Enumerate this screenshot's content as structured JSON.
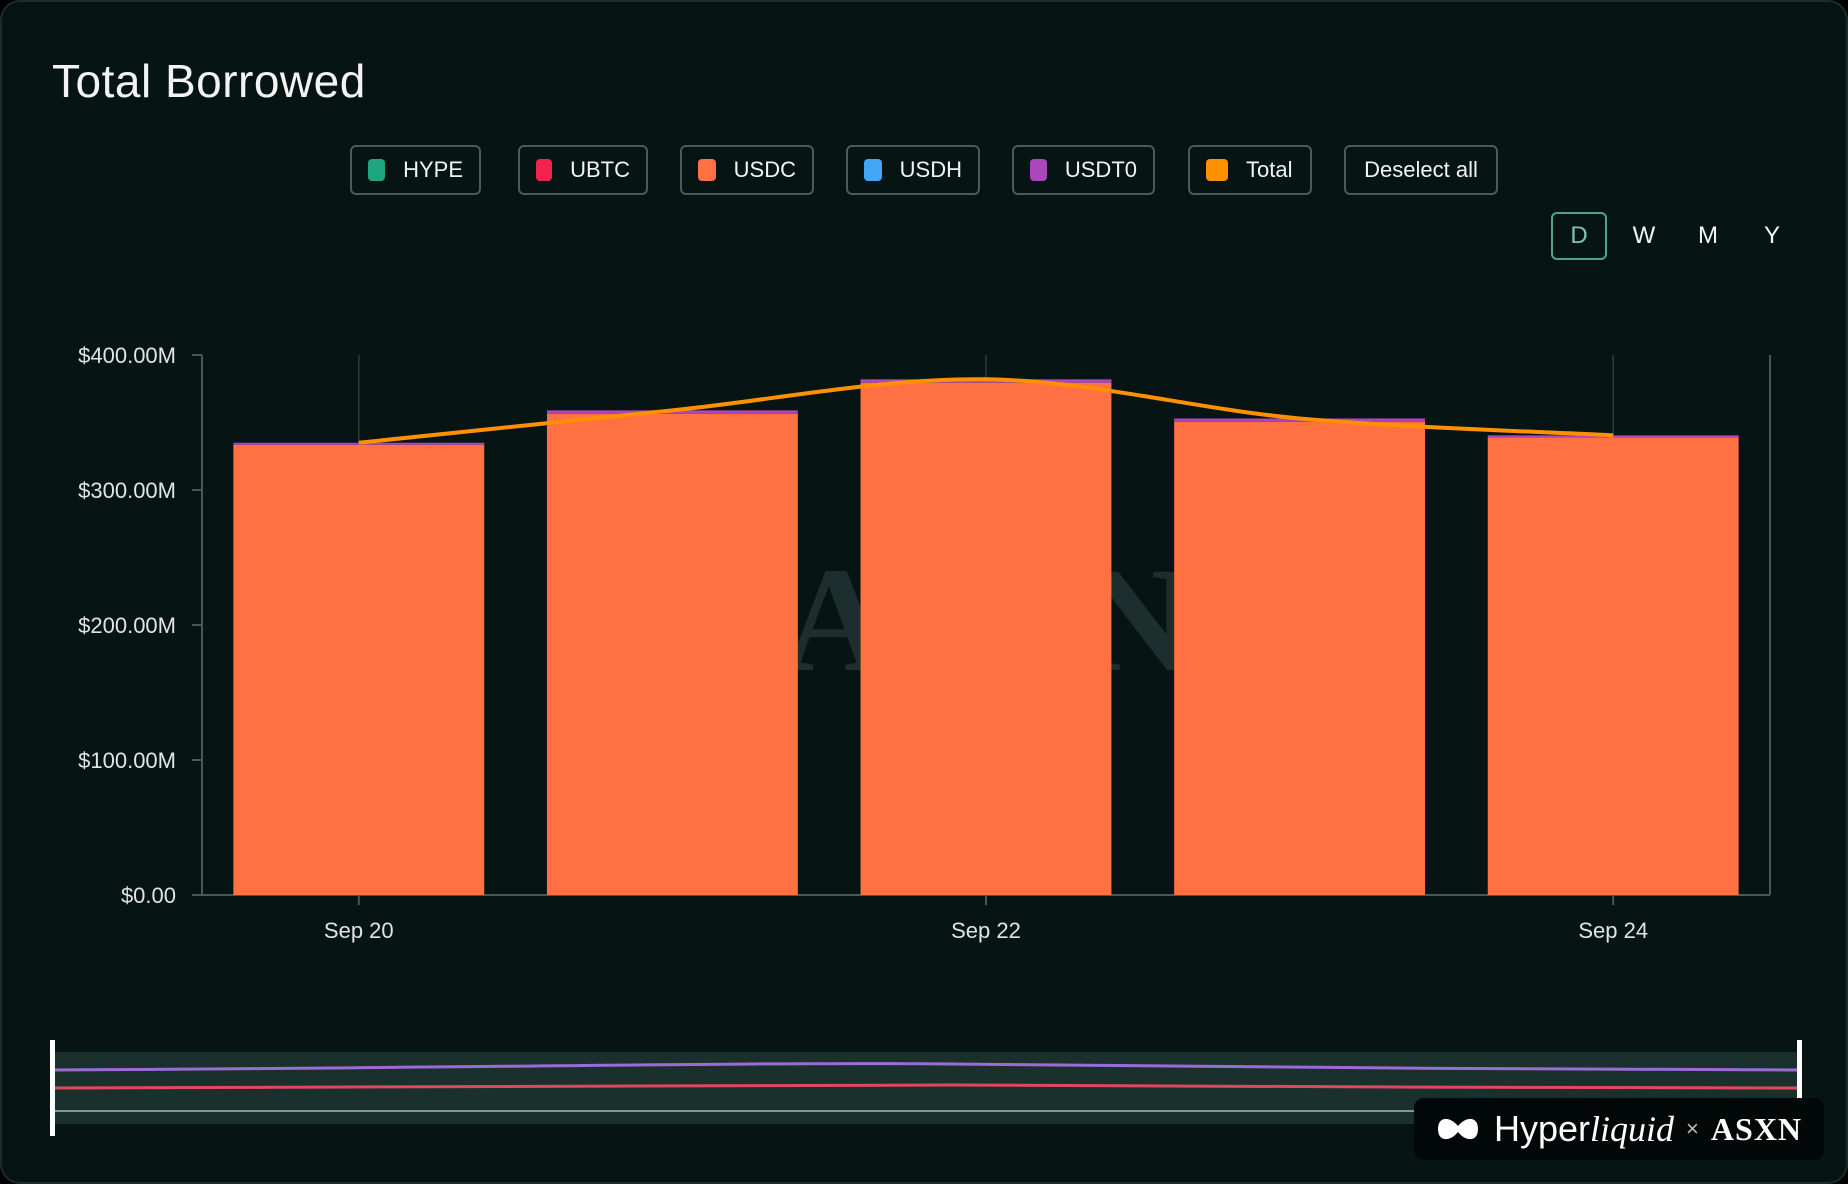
{
  "title": "Total Borrowed",
  "legend": [
    {
      "label": "HYPE",
      "color": "#1ea77f"
    },
    {
      "label": "UBTC",
      "color": "#f2224e"
    },
    {
      "label": "USDC",
      "color": "#ff7043"
    },
    {
      "label": "USDH",
      "color": "#42a5f5"
    },
    {
      "label": "USDT0",
      "color": "#ab47bc"
    },
    {
      "label": "Total",
      "color": "#ff9100"
    }
  ],
  "deselect_label": "Deselect all",
  "periods": [
    "D",
    "W",
    "M",
    "Y"
  ],
  "active_period": "D",
  "watermark": "ASXN",
  "brand": {
    "hyper": "Hyper",
    "liquid": "liquid",
    "x": "×",
    "asxn": "ASXN"
  },
  "chart_data": {
    "type": "bar",
    "stacked": true,
    "categories": [
      "Sep 20",
      "Sep 21",
      "Sep 22",
      "Sep 23",
      "Sep 24"
    ],
    "x_tick_labels": [
      "Sep 20",
      "Sep 22",
      "Sep 24"
    ],
    "y_tick_labels": [
      "$0.00",
      "$100.00M",
      "$200.00M",
      "$300.00M",
      "$400.00M"
    ],
    "ylim": [
      0,
      400
    ],
    "y_unit": "M USD",
    "series": [
      {
        "name": "USDC",
        "type": "bar",
        "color": "#ff7043",
        "values": [
          333.5,
          356.5,
          379.5,
          350.5,
          339
        ]
      },
      {
        "name": "USDT0",
        "type": "bar",
        "color": "#ab47bc",
        "values": [
          1.5,
          2.5,
          2.5,
          2.5,
          1.5
        ]
      },
      {
        "name": "Total",
        "type": "line",
        "color": "#ff9100",
        "values": [
          335,
          359,
          382,
          353,
          340.5
        ]
      }
    ],
    "grid": false
  }
}
